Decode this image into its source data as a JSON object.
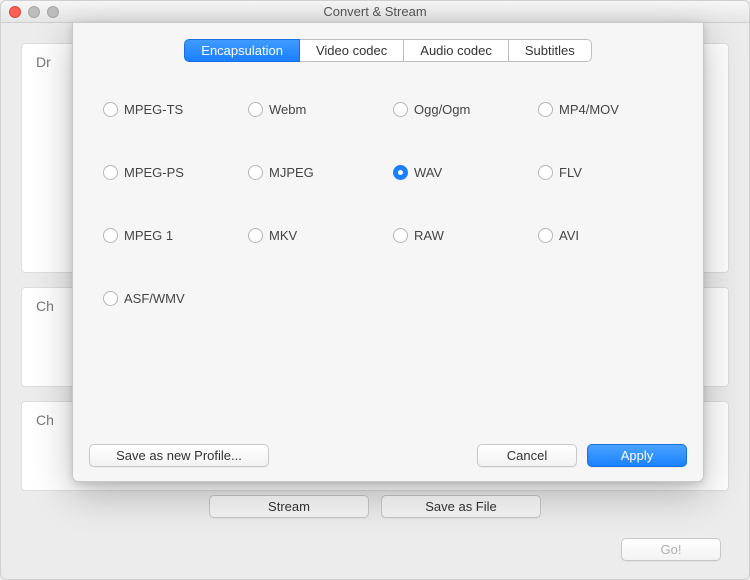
{
  "window": {
    "title": "Convert & Stream"
  },
  "back": {
    "panel1_label": "Dr",
    "panel2_label": "Ch",
    "panel3_label": "Ch",
    "stream_btn": "Stream",
    "save_file_btn": "Save as File",
    "go_btn": "Go!"
  },
  "sheet": {
    "tabs": [
      {
        "label": "Encapsulation",
        "selected": true
      },
      {
        "label": "Video codec",
        "selected": false
      },
      {
        "label": "Audio codec",
        "selected": false
      },
      {
        "label": "Subtitles",
        "selected": false
      }
    ],
    "options": [
      {
        "label": "MPEG-TS",
        "selected": false
      },
      {
        "label": "Webm",
        "selected": false
      },
      {
        "label": "Ogg/Ogm",
        "selected": false
      },
      {
        "label": "MP4/MOV",
        "selected": false
      },
      {
        "label": "MPEG-PS",
        "selected": false
      },
      {
        "label": "MJPEG",
        "selected": false
      },
      {
        "label": "WAV",
        "selected": true
      },
      {
        "label": "FLV",
        "selected": false
      },
      {
        "label": "MPEG 1",
        "selected": false
      },
      {
        "label": "MKV",
        "selected": false
      },
      {
        "label": "RAW",
        "selected": false
      },
      {
        "label": "AVI",
        "selected": false
      },
      {
        "label": "ASF/WMV",
        "selected": false
      }
    ],
    "save_profile_btn": "Save as new Profile...",
    "cancel_btn": "Cancel",
    "apply_btn": "Apply"
  }
}
